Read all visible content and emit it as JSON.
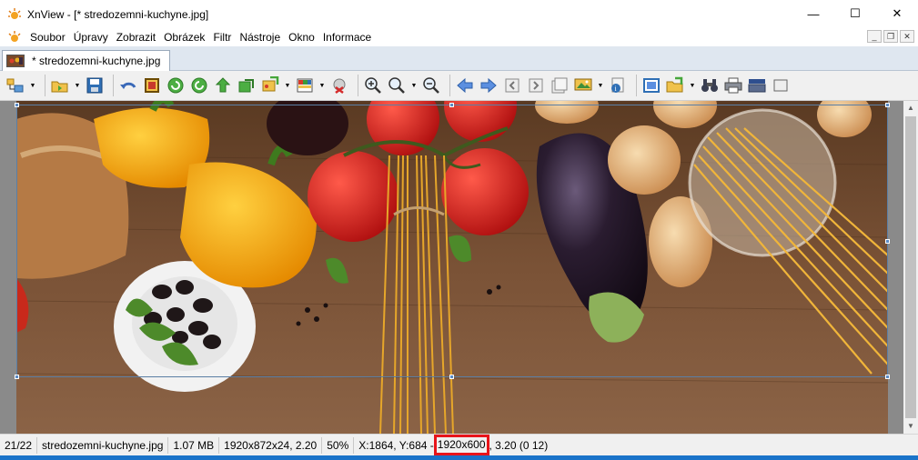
{
  "window": {
    "title": "XnView - [* stredozemni-kuchyne.jpg]",
    "controls": {
      "minimize": "—",
      "maximize": "☐",
      "close": "✕"
    }
  },
  "menu": {
    "items": [
      "Soubor",
      "Úpravy",
      "Zobrazit",
      "Obrázek",
      "Filtr",
      "Nástroje",
      "Okno",
      "Informace"
    ],
    "mdi": {
      "minimize": "_",
      "restore": "❐",
      "close": "✕"
    }
  },
  "tab": {
    "label": "* stredozemni-kuchyne.jpg"
  },
  "toolbar": {
    "icons": [
      "browser-icon",
      "open-folder-icon",
      "save-icon",
      "undo-icon",
      "crop-icon",
      "rotate-left-icon",
      "rotate-right-icon",
      "flip-icon",
      "copy-icon",
      "import-icon",
      "palette-icon",
      "redeye-icon",
      "zoom-in-icon",
      "zoom-1-1-icon",
      "zoom-out-icon",
      "prev-arrow-icon",
      "next-arrow-icon",
      "first-page-icon",
      "next-page-icon",
      "last-page-icon",
      "slideshow-icon",
      "info-icon",
      "fullscreen-icon",
      "export-icon",
      "binoculars-icon",
      "print-icon",
      "scanner-icon"
    ]
  },
  "status": {
    "index": "21/22",
    "filename": "stredozemni-kuchyne.jpg",
    "filesize": "1.07 MB",
    "dimensions": "1920x872x24, 2.20",
    "zoom": "50%",
    "position": "X:1864, Y:684 -",
    "selection_size": "1920x600",
    "ratio": ", 3.20 (0 12)"
  },
  "colors": {
    "highlight": "#e8141a",
    "tabbar": "#dfe7f0",
    "selection": "#5b7fa5"
  }
}
